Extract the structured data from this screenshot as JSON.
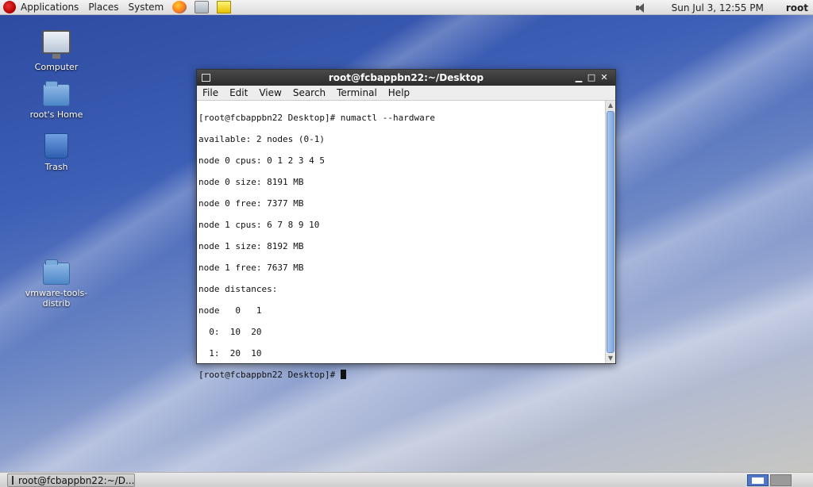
{
  "top_panel": {
    "menus": [
      "Applications",
      "Places",
      "System"
    ],
    "clock": "Sun Jul  3, 12:55 PM",
    "user": "root"
  },
  "desktop_icons": [
    {
      "label": "Computer"
    },
    {
      "label": "root's Home"
    },
    {
      "label": "Trash"
    },
    {
      "label": "vmware-tools-distrib"
    }
  ],
  "terminal": {
    "title": "root@fcbappbn22:~/Desktop",
    "menu": [
      "File",
      "Edit",
      "View",
      "Search",
      "Terminal",
      "Help"
    ],
    "lines": [
      "[root@fcbappbn22 Desktop]# numactl --hardware",
      "available: 2 nodes (0-1)",
      "node 0 cpus: 0 1 2 3 4 5",
      "node 0 size: 8191 MB",
      "node 0 free: 7377 MB",
      "node 1 cpus: 6 7 8 9 10",
      "node 1 size: 8192 MB",
      "node 1 free: 7637 MB",
      "node distances:",
      "node   0   1",
      "  0:  10  20",
      "  1:  20  10"
    ],
    "prompt": "[root@fcbappbn22 Desktop]# "
  },
  "taskbar": {
    "task_label": "root@fcbappbn22:~/D..."
  }
}
